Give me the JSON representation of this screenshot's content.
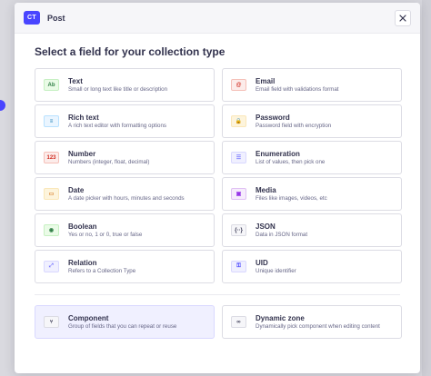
{
  "header": {
    "badge": "CT",
    "title": "Post"
  },
  "section_title": "Select a field for your collection type",
  "fields": [
    {
      "label": "Text",
      "desc": "Small or long text like title or description",
      "icon": "text-icon",
      "glyph": "Ab",
      "color": "#328048",
      "bg": "#eafbe7",
      "border": "#c6f0c2"
    },
    {
      "label": "Email",
      "desc": "Email field with validations format",
      "icon": "at-icon",
      "glyph": "@",
      "color": "#d02b20",
      "bg": "#fcecea",
      "border": "#f5c0b8"
    },
    {
      "label": "Rich text",
      "desc": "A rich text editor with formatting options",
      "icon": "paragraph-icon",
      "glyph": "≡",
      "color": "#0c75af",
      "bg": "#eaf5ff",
      "border": "#b8e1ff"
    },
    {
      "label": "Password",
      "desc": "Password field with encryption",
      "icon": "lock-icon",
      "glyph": "🔒",
      "color": "#d9822f",
      "bg": "#fdf4dc",
      "border": "#fae7b9"
    },
    {
      "label": "Number",
      "desc": "Numbers (integer, float, decimal)",
      "icon": "number-icon",
      "glyph": "123",
      "color": "#d02b20",
      "bg": "#fcecea",
      "border": "#f5c0b8"
    },
    {
      "label": "Enumeration",
      "desc": "List of values, then pick one",
      "icon": "list-icon",
      "glyph": "☰",
      "color": "#7b79ff",
      "bg": "#f0f0ff",
      "border": "#d9d8ff"
    },
    {
      "label": "Date",
      "desc": "A date picker with hours, minutes and seconds",
      "icon": "calendar-icon",
      "glyph": "▭",
      "color": "#d9822f",
      "bg": "#fdf4dc",
      "border": "#fae7b9"
    },
    {
      "label": "Media",
      "desc": "Files like images, videos, etc",
      "icon": "media-icon",
      "glyph": "▣",
      "color": "#9736e8",
      "bg": "#f6ecfc",
      "border": "#e0c1f4"
    },
    {
      "label": "Boolean",
      "desc": "Yes or no, 1 or 0, true or false",
      "icon": "toggle-icon",
      "glyph": "◉",
      "color": "#328048",
      "bg": "#eafbe7",
      "border": "#c6f0c2"
    },
    {
      "label": "JSON",
      "desc": "Data in JSON format",
      "icon": "json-icon",
      "glyph": "{··}",
      "color": "#32324d",
      "bg": "#f6f6f9",
      "border": "#dcdce4"
    },
    {
      "label": "Relation",
      "desc": "Refers to a Collection Type",
      "icon": "relation-icon",
      "glyph": "⤢",
      "color": "#7b79ff",
      "bg": "#f0f0ff",
      "border": "#d9d8ff"
    },
    {
      "label": "UID",
      "desc": "Unique identifier",
      "icon": "key-icon",
      "glyph": "⚿",
      "color": "#4945ff",
      "bg": "#f0f0ff",
      "border": "#d9d8ff"
    }
  ],
  "extras": [
    {
      "label": "Component",
      "desc": "Group of fields that you can repeat or reuse",
      "icon": "component-icon",
      "glyph": "⑂",
      "color": "#32324d",
      "bg": "#f6f6f9",
      "border": "#dcdce4",
      "selected": true
    },
    {
      "label": "Dynamic zone",
      "desc": "Dynamically pick component when editing content",
      "icon": "infinity-icon",
      "glyph": "∞",
      "color": "#32324d",
      "bg": "#f6f6f9",
      "border": "#dcdce4",
      "selected": false
    }
  ]
}
